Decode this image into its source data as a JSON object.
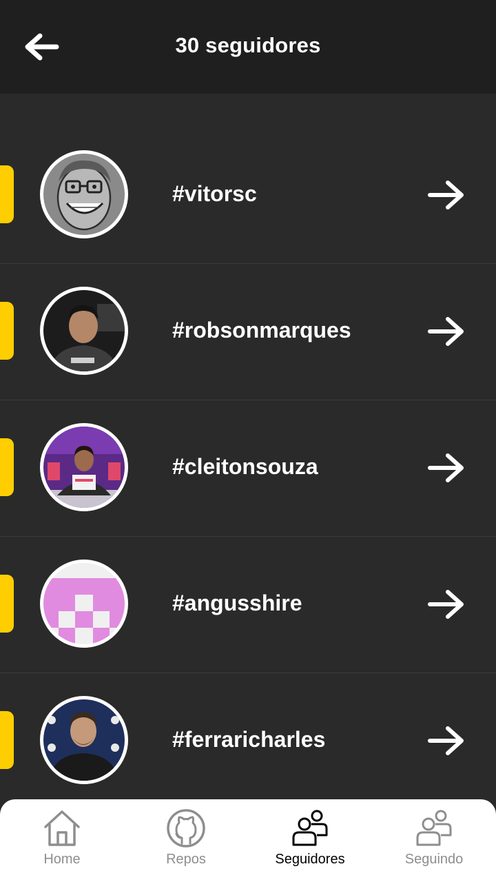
{
  "header": {
    "title": "30 seguidores",
    "back_icon": "arrow-left-icon"
  },
  "colors": {
    "header_bg": "#1f1f1f",
    "list_bg": "#2a2a2a",
    "accent": "#FFCE00",
    "text": "#ffffff",
    "tab_inactive": "#8e8e8e",
    "tab_active": "#000000"
  },
  "followers": [
    {
      "username": "#vitorsc",
      "avatar": "caricature-avatar"
    },
    {
      "username": "#robsonmarques",
      "avatar": "photo-avatar"
    },
    {
      "username": "#cleitonsouza",
      "avatar": "photo-avatar"
    },
    {
      "username": "#angusshire",
      "avatar": "identicon-avatar"
    },
    {
      "username": "#ferraricharles",
      "avatar": "photo-avatar"
    }
  ],
  "tabs": [
    {
      "label": "Home",
      "icon": "home-icon",
      "active": false
    },
    {
      "label": "Repos",
      "icon": "github-icon",
      "active": false
    },
    {
      "label": "Seguidores",
      "icon": "users-icon",
      "active": true
    },
    {
      "label": "Seguindo",
      "icon": "users-icon",
      "active": false
    }
  ]
}
